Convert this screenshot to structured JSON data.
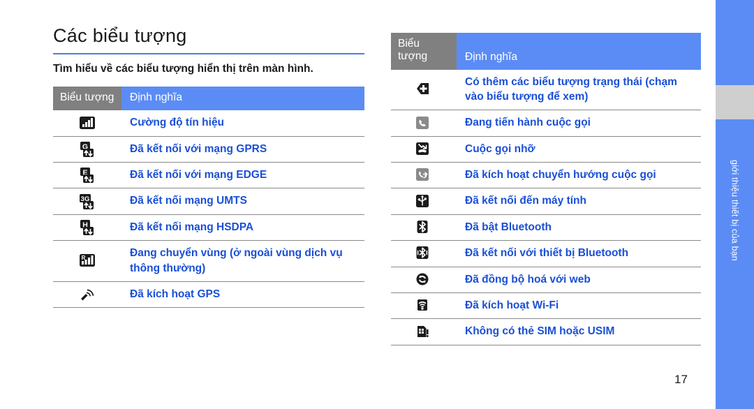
{
  "page": {
    "number": "17",
    "accent_blue": "#5b8cf5",
    "link_blue": "#1a4fd6",
    "header_gray": "#808080"
  },
  "side_tab": {
    "label": "giới thiệu thiết bị của bạn"
  },
  "left": {
    "title": "Các biểu tượng",
    "intro": "Tìm hiểu về các biểu tượng hiển thị trên màn hình.",
    "table": {
      "header": {
        "icon": "Biểu tượng",
        "definition": "Định nghĩa"
      },
      "rows": [
        {
          "icon": "signal-strength-icon",
          "definition": "Cường độ tín hiệu"
        },
        {
          "icon": "gprs-connected-icon",
          "definition": "Đã kết nối với mạng GPRS"
        },
        {
          "icon": "edge-connected-icon",
          "definition": "Đã kết nối với mạng EDGE"
        },
        {
          "icon": "umts-connected-icon",
          "definition": "Đã kết nối mạng UMTS"
        },
        {
          "icon": "hsdpa-connected-icon",
          "definition": "Đã kết nối mạng HSDPA"
        },
        {
          "icon": "roaming-icon",
          "definition": "Đang chuyển vùng (ở ngoài vùng dịch vụ thông thường)"
        },
        {
          "icon": "gps-active-icon",
          "definition": "Đã kích hoạt GPS"
        }
      ]
    }
  },
  "right": {
    "table": {
      "header": {
        "icon": "Biểu tượng",
        "definition": "Định nghĩa"
      },
      "rows": [
        {
          "icon": "more-status-icons-icon",
          "definition": "Có thêm các biểu tượng trạng thái (chạm vào biểu tượng để xem)"
        },
        {
          "icon": "call-in-progress-icon",
          "definition": "Đang tiến hành cuộc gọi"
        },
        {
          "icon": "missed-call-icon",
          "definition": "Cuộc gọi nhỡ"
        },
        {
          "icon": "call-forwarding-icon",
          "definition": "Đã kích hoạt chuyển hướng cuộc gọi"
        },
        {
          "icon": "usb-connected-icon",
          "definition": "Đã kết nối đến máy tính"
        },
        {
          "icon": "bluetooth-on-icon",
          "definition": "Đã bật Bluetooth"
        },
        {
          "icon": "bluetooth-connected-icon",
          "definition": "Đã kết nối với thiết bị Bluetooth"
        },
        {
          "icon": "web-sync-icon",
          "definition": "Đã đồng bộ hoá với web"
        },
        {
          "icon": "wifi-active-icon",
          "definition": "Đã kích hoạt Wi-Fi"
        },
        {
          "icon": "no-sim-card-icon",
          "definition": "Không có thẻ SIM hoặc USIM"
        }
      ]
    }
  }
}
